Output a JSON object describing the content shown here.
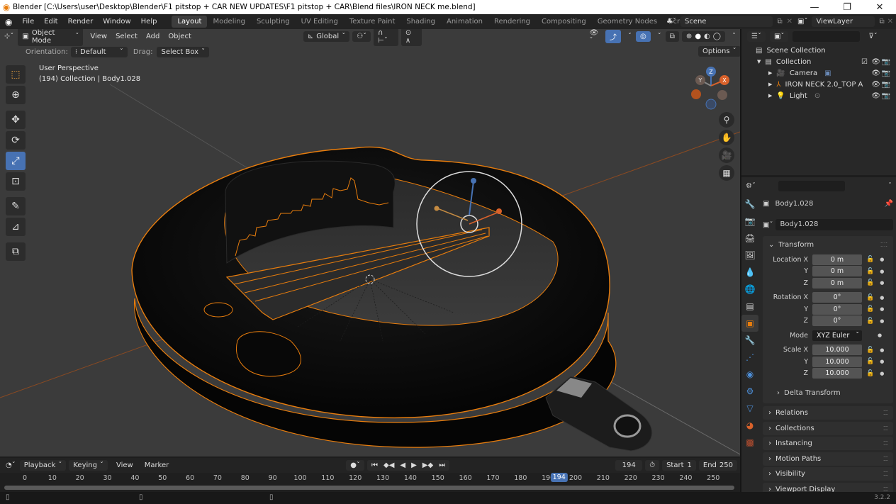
{
  "window": {
    "title": "Blender [C:\\Users\\user\\Desktop\\Blender\\F1 pitstop + CAR NEW UPDATES\\F1 pitstop + CAR\\Blend files\\IRON NECK me.blend]",
    "minimize": "—",
    "maximize": "❐",
    "close": "✕"
  },
  "menus": [
    "File",
    "Edit",
    "Render",
    "Window",
    "Help"
  ],
  "workspaces": [
    "Layout",
    "Modeling",
    "Sculpting",
    "UV Editing",
    "Texture Paint",
    "Shading",
    "Animation",
    "Rendering",
    "Compositing",
    "Geometry Nodes",
    "Scripting"
  ],
  "active_workspace": "Layout",
  "add_workspace": "+",
  "scene": {
    "label": "Scene"
  },
  "view_layer": {
    "label": "ViewLayer"
  },
  "viewport": {
    "mode": "Object Mode",
    "menus": [
      "View",
      "Select",
      "Add",
      "Object"
    ],
    "transform_orientation": "Global",
    "options": "Options",
    "orientation_label": "Orientation:",
    "orientation_value": "Default",
    "drag_label": "Drag:",
    "drag_value": "Select Box",
    "overlay_line1": "User Perspective",
    "overlay_line2": "(194) Collection | Body1.028",
    "gizmo_axes": {
      "x": "X",
      "y": "Y",
      "z": "Z"
    },
    "colors": {
      "selection_outline": "#e87d0d",
      "active_blue": "#4772b3",
      "background": "#3b3b3b"
    }
  },
  "tools": [
    {
      "name": "select-box",
      "glyph": "⬚"
    },
    {
      "name": "cursor",
      "glyph": "⊕"
    },
    {
      "name": "move",
      "glyph": "✥"
    },
    {
      "name": "rotate",
      "glyph": "⟳"
    },
    {
      "name": "scale",
      "glyph": "⤢",
      "active": true
    },
    {
      "name": "transform",
      "glyph": "⊡"
    },
    {
      "name": "annotate",
      "glyph": "✎"
    },
    {
      "name": "measure",
      "glyph": "📐"
    },
    {
      "name": "add-cube",
      "glyph": "⧉"
    }
  ],
  "nav_buttons": [
    {
      "name": "zoom",
      "glyph": "🔍"
    },
    {
      "name": "pan",
      "glyph": "✋"
    },
    {
      "name": "camera-view",
      "glyph": "🎥"
    },
    {
      "name": "ortho-toggle",
      "glyph": "▦"
    }
  ],
  "outliner": {
    "search_placeholder": "",
    "items": [
      {
        "label": "Scene Collection",
        "level": 0
      },
      {
        "label": "Collection",
        "level": 1
      },
      {
        "label": "Camera",
        "level": 2
      },
      {
        "label": "IRON NECK 2.0_TOP A",
        "level": 2
      },
      {
        "label": "Light",
        "level": 2
      }
    ]
  },
  "properties": {
    "search_placeholder": "",
    "object_name_header": "Body1.028",
    "object_name_field": "Body1.028",
    "transform": {
      "title": "Transform",
      "location_label": "Location X",
      "rotation_label": "Rotation X",
      "mode_label": "Mode",
      "scale_label": "Scale X",
      "axis_y": "Y",
      "axis_z": "Z",
      "location": [
        "0 m",
        "0 m",
        "0 m"
      ],
      "rotation": [
        "0°",
        "0°",
        "0°"
      ],
      "mode": "XYZ Euler",
      "scale": [
        "10.000",
        "10.000",
        "10.000"
      ]
    },
    "delta_transform": "Delta Transform",
    "panels": [
      "Relations",
      "Collections",
      "Instancing",
      "Motion Paths",
      "Visibility",
      "Viewport Display"
    ]
  },
  "timeline": {
    "menus": [
      "Playback",
      "Keying",
      "View",
      "Marker"
    ],
    "current_frame": "194",
    "start_label": "Start",
    "start": "1",
    "end_label": "End",
    "end": "250",
    "ticks": [
      "0",
      "10",
      "20",
      "30",
      "40",
      "50",
      "60",
      "70",
      "80",
      "90",
      "100",
      "110",
      "120",
      "130",
      "140",
      "150",
      "160",
      "170",
      "180",
      "190",
      "200",
      "210",
      "220",
      "230",
      "240",
      "250"
    ]
  },
  "status": {
    "version": "3.2.2"
  }
}
